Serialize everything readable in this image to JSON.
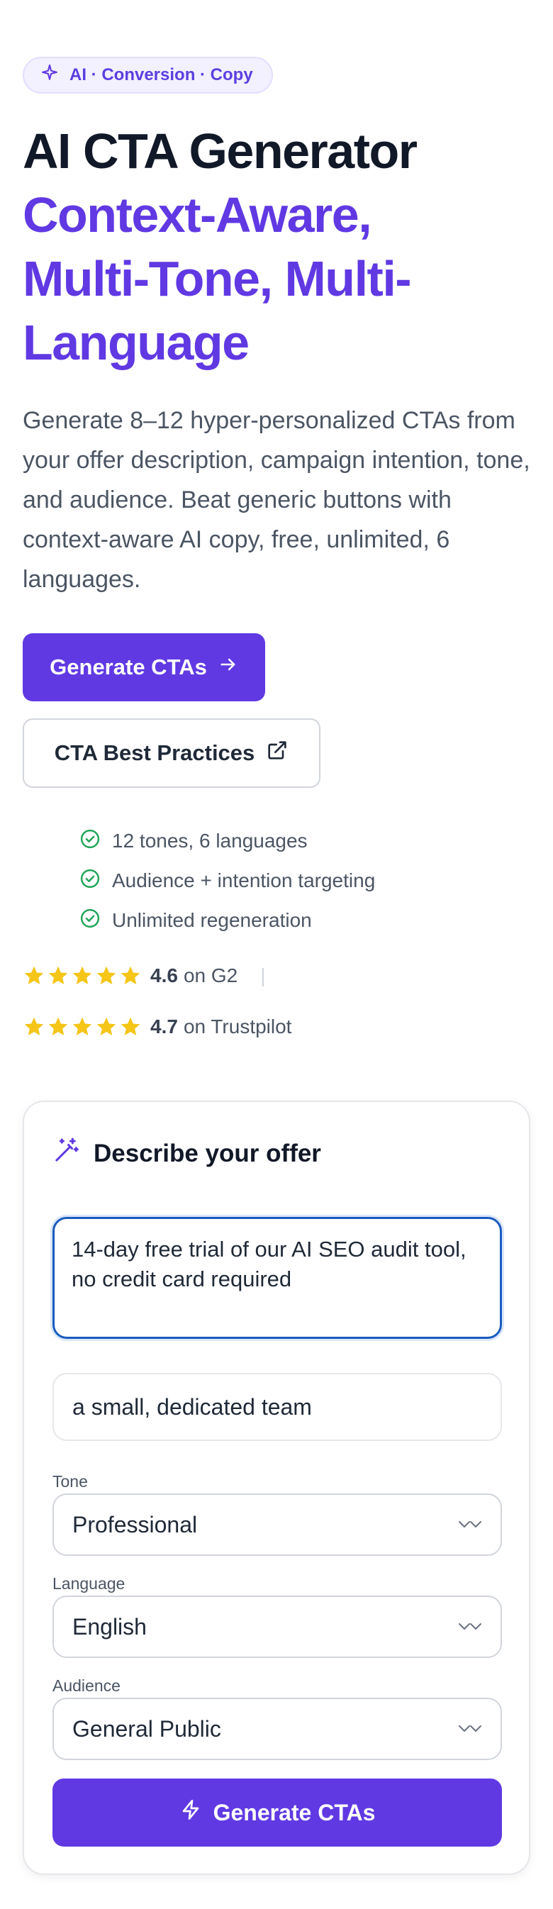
{
  "badge": {
    "label": "AI · Conversion · Copy",
    "icon": "sparkle-icon"
  },
  "hero": {
    "title_line1": "AI CTA Generator",
    "title_accent_line1": "Context-Aware,",
    "title_accent_line2": "Multi-Tone, Multi-",
    "title_accent_line3": "Language",
    "description": "Generate 8–12 hyper-personalized CTAs from your offer description, campaign intention, tone, and audience. Beat generic buttons with context-aware AI copy, free, unlimited, 6 languages."
  },
  "buttons": {
    "primary_label": "Generate CTAs",
    "secondary_label": "CTA Best Practices"
  },
  "features": [
    "12 tones, 6 languages",
    "Audience + intention targeting",
    "Unlimited regeneration"
  ],
  "ratings": [
    {
      "stars": 5,
      "score": "4.6",
      "source": "on G2",
      "separator": "|"
    },
    {
      "stars": 5,
      "score": "4.7",
      "source": "on Trustpilot"
    }
  ],
  "form": {
    "title": "Describe your offer",
    "offer_value": "14-day free trial of our AI SEO audit tool, no credit card required",
    "audience_detail_value": "a small, dedicated team",
    "tone": {
      "label": "Tone",
      "value": "Professional"
    },
    "language": {
      "label": "Language",
      "value": "English"
    },
    "audience": {
      "label": "Audience",
      "value": "General Public"
    },
    "submit_label": "Generate CTAs"
  },
  "colors": {
    "accent": "#6039e3",
    "star": "#f5c518",
    "check": "#22a55a",
    "focus": "#1a5bbf"
  }
}
